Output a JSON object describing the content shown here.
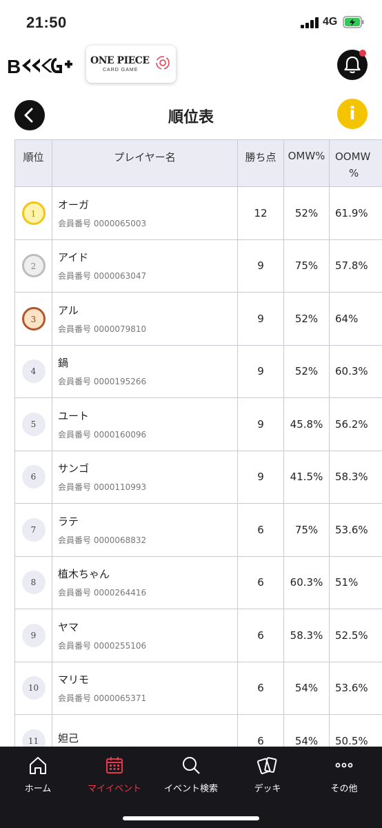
{
  "status_bar": {
    "time": "21:50",
    "network": "4G"
  },
  "header": {
    "brand_logo_text": "BKG+",
    "partner_logo": {
      "title": "ONE PIECE",
      "subtitle": "CARD GAME"
    }
  },
  "page": {
    "title": "順位表"
  },
  "table": {
    "headers": {
      "rank": "順位",
      "name": "プレイヤー名",
      "points": "勝ち点",
      "omw": "OMW%",
      "oomw_line1": "OOMW",
      "oomw_line2": "%"
    },
    "rows": [
      {
        "rank": "1",
        "name": "オーガ",
        "member_id": "会員番号 0000065003",
        "points": "12",
        "omw": "52%",
        "oomw": "61.9%"
      },
      {
        "rank": "2",
        "name": "アイド",
        "member_id": "会員番号 0000063047",
        "points": "9",
        "omw": "75%",
        "oomw": "57.8%"
      },
      {
        "rank": "3",
        "name": "アル",
        "member_id": "会員番号 0000079810",
        "points": "9",
        "omw": "52%",
        "oomw": "64%"
      },
      {
        "rank": "4",
        "name": "鍋",
        "member_id": "会員番号 0000195266",
        "points": "9",
        "omw": "52%",
        "oomw": "60.3%"
      },
      {
        "rank": "5",
        "name": "ユート",
        "member_id": "会員番号 0000160096",
        "points": "9",
        "omw": "45.8%",
        "oomw": "56.2%"
      },
      {
        "rank": "6",
        "name": "サンゴ",
        "member_id": "会員番号 0000110993",
        "points": "9",
        "omw": "41.5%",
        "oomw": "58.3%"
      },
      {
        "rank": "7",
        "name": "ラテ",
        "member_id": "会員番号 0000068832",
        "points": "6",
        "omw": "75%",
        "oomw": "53.6%"
      },
      {
        "rank": "8",
        "name": "植木ちゃん",
        "member_id": "会員番号 0000264416",
        "points": "6",
        "omw": "60.3%",
        "oomw": "51%"
      },
      {
        "rank": "9",
        "name": "ヤマ",
        "member_id": "会員番号 0000255106",
        "points": "6",
        "omw": "58.3%",
        "oomw": "52.5%"
      },
      {
        "rank": "10",
        "name": "マリモ",
        "member_id": "会員番号 0000065371",
        "points": "6",
        "omw": "54%",
        "oomw": "53.6%"
      },
      {
        "rank": "11",
        "name": "妲己",
        "member_id": "",
        "points": "6",
        "omw": "54%",
        "oomw": "50.5%"
      }
    ]
  },
  "nav": {
    "items": [
      {
        "label": "ホーム",
        "icon": "home-icon"
      },
      {
        "label": "マイイベント",
        "icon": "calendar-icon",
        "active": true
      },
      {
        "label": "イベント検索",
        "icon": "search-icon"
      },
      {
        "label": "デッキ",
        "icon": "cards-icon"
      },
      {
        "label": "その他",
        "icon": "more-icon"
      }
    ]
  },
  "colors": {
    "accent": "#e8394b",
    "info": "#f5c400",
    "nav_bg": "#17171c",
    "header_bg": "#ebebf4"
  }
}
